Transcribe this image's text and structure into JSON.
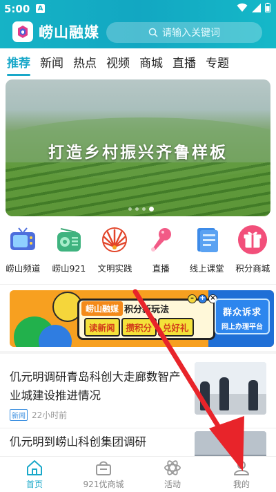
{
  "status_bar": {
    "time": "5:00",
    "badge": "A"
  },
  "header": {
    "app_name": "崂山融媒",
    "search_placeholder": "请输入关键词"
  },
  "tabs": [
    {
      "label": "推荐",
      "active": true
    },
    {
      "label": "新闻"
    },
    {
      "label": "热点"
    },
    {
      "label": "视频"
    },
    {
      "label": "商城"
    },
    {
      "label": "直播"
    },
    {
      "label": "专题"
    }
  ],
  "banner": {
    "caption": "打造乡村振兴齐鲁样板",
    "slide_count": 4,
    "active_slide": 4
  },
  "channels": [
    {
      "label": "崂山频道",
      "icon": "tv-icon"
    },
    {
      "label": "崂山921",
      "icon": "radio-icon"
    },
    {
      "label": "文明实践",
      "icon": "fan-icon"
    },
    {
      "label": "直播",
      "icon": "microphone-icon"
    },
    {
      "label": "线上课堂",
      "icon": "document-icon"
    },
    {
      "label": "积分商城",
      "icon": "gift-icon"
    }
  ],
  "promo": {
    "brand": "崂山融媒",
    "headline": "积分新玩法",
    "slogans": [
      "读新闻",
      "攒积分",
      "兑好礼"
    ],
    "right_title": "群众诉求",
    "right_sub": "网上办理平台"
  },
  "news": [
    {
      "title": "仉元明调研青岛科创大走廊数智产业城建设推进情况",
      "tag": "新闻",
      "time": "22小时前"
    },
    {
      "title": "仉元明到崂山科创集团调研"
    }
  ],
  "bottom_nav": [
    {
      "label": "首页",
      "icon": "home-icon",
      "active": true
    },
    {
      "label": "921优商城",
      "icon": "shop-icon"
    },
    {
      "label": "活动",
      "icon": "atom-icon"
    },
    {
      "label": "我的",
      "icon": "user-icon"
    }
  ],
  "colors": {
    "accent": "#1aa8c9",
    "annotation": "#e8242a"
  }
}
